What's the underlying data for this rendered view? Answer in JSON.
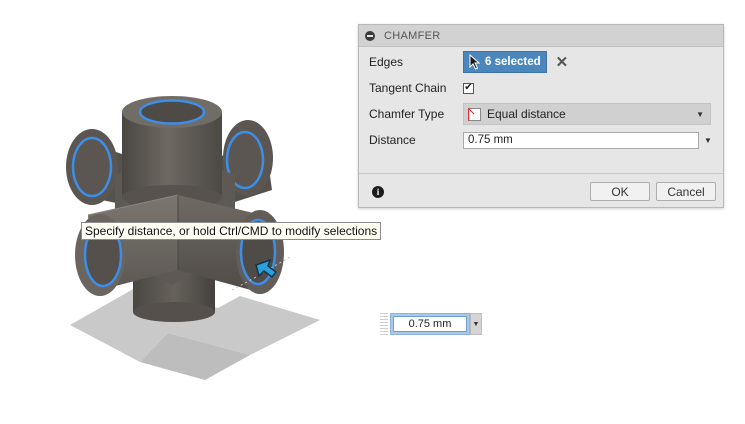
{
  "dialog": {
    "title": "CHAMFER",
    "edges_label": "Edges",
    "edges_value": "6 selected",
    "tangent_chain_label": "Tangent Chain",
    "tangent_chain_checked": true,
    "chamfer_type_label": "Chamfer Type",
    "chamfer_type_value": "Equal distance",
    "distance_label": "Distance",
    "distance_value": "0.75 mm",
    "ok_label": "OK",
    "cancel_label": "Cancel"
  },
  "tooltip": {
    "text": "Specify distance, or hold Ctrl/CMD to modify selections"
  },
  "float_input": {
    "value": "0.75 mm"
  },
  "icons": {
    "collapse": "minus-circle-icon",
    "cursor": "arrow-cursor-icon",
    "clear": "x-icon",
    "chamfer_type": "equal-distance-icon",
    "info": "info-icon",
    "manipulator": "arrow-manipulator-icon"
  },
  "colors": {
    "selection_chip": "#4b86bd",
    "edge_highlight": "#3d8ee6",
    "model_body": "#5f5a55",
    "manipulator": "#2a9fd8"
  }
}
